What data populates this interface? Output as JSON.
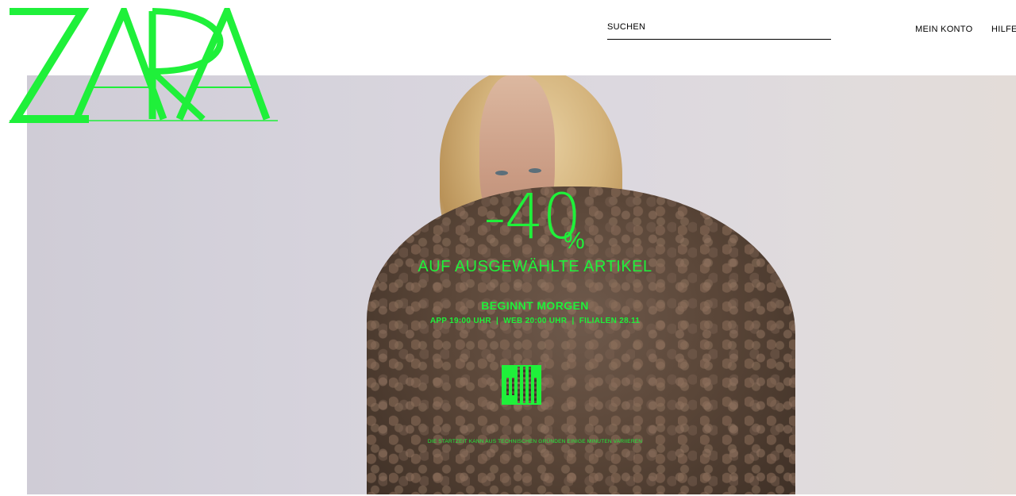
{
  "brand": {
    "logo_text": "ZARA",
    "accent_color": "#1ff03a"
  },
  "header": {
    "search_label": "SUCHEN",
    "account_label": "MEIN KONTO",
    "help_label": "HILFE"
  },
  "promo": {
    "discount": "-40",
    "percent_sign": "%",
    "subtitle": "AUF AUSGEWÄHLTE ARTIKEL",
    "starts": "BEGINNT MORGEN",
    "times": "APP 19:00 UHR  |  WEB 20:00 UHR  |  FILIALEN 28.11",
    "qr_icon": "qr-code-icon",
    "disclaimer": "DIE STARTZEIT KANN AUS TECHNISCHEN GRÜNDEN EINIGE MINUTEN VARIIEREN"
  }
}
